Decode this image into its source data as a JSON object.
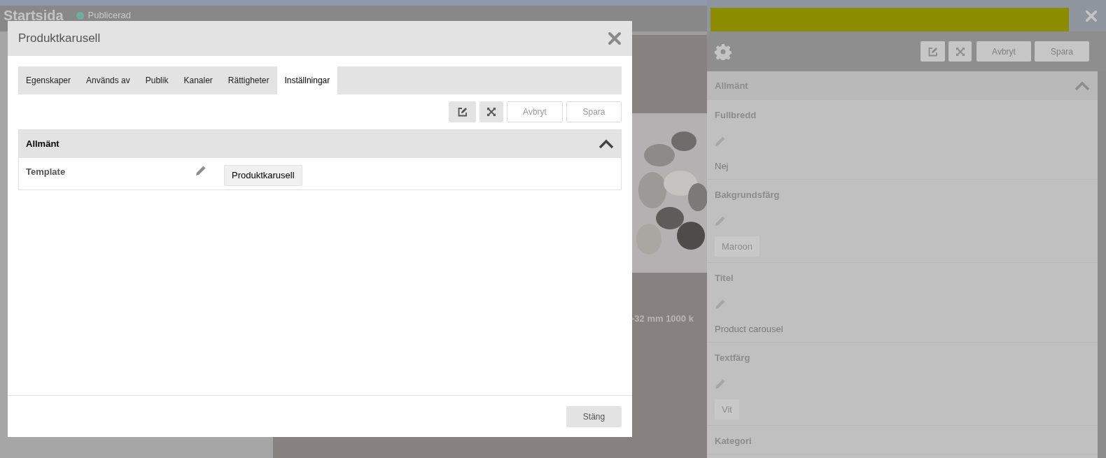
{
  "background_page": {
    "title": "Startsida",
    "status": {
      "label": "Publicerad",
      "color": "#6fae9c"
    },
    "product_caption": "-32 mm 1000 k"
  },
  "dialog": {
    "title": "Produktkarusell",
    "tabs": [
      {
        "label": "Egenskaper",
        "selected": false
      },
      {
        "label": "Används av",
        "selected": false
      },
      {
        "label": "Publik",
        "selected": false
      },
      {
        "label": "Kanaler",
        "selected": false
      },
      {
        "label": "Rättigheter",
        "selected": false
      },
      {
        "label": "Inställningar",
        "selected": true
      }
    ],
    "toolbar": {
      "cancel": "Avbryt",
      "save": "Spara"
    },
    "section": {
      "title": "Allmänt",
      "expanded": true,
      "rows": [
        {
          "label": "Template",
          "value": "Produktkarusell"
        }
      ]
    },
    "footer_button": "Stäng"
  },
  "settings_panel": {
    "toolbar": {
      "cancel": "Avbryt",
      "save": "Spara"
    },
    "section": {
      "title": "Allmänt",
      "expanded": true,
      "fields": [
        {
          "label": "Fullbredd",
          "kind": "text",
          "value": "Nej"
        },
        {
          "label": "Bakgrundsfärg",
          "kind": "chip",
          "value": "Maroon"
        },
        {
          "label": "Titel",
          "kind": "text",
          "value": "Product carousel"
        },
        {
          "label": "Textfärg",
          "kind": "chip",
          "value": "Vit"
        },
        {
          "label": "Kategori"
        }
      ]
    }
  }
}
